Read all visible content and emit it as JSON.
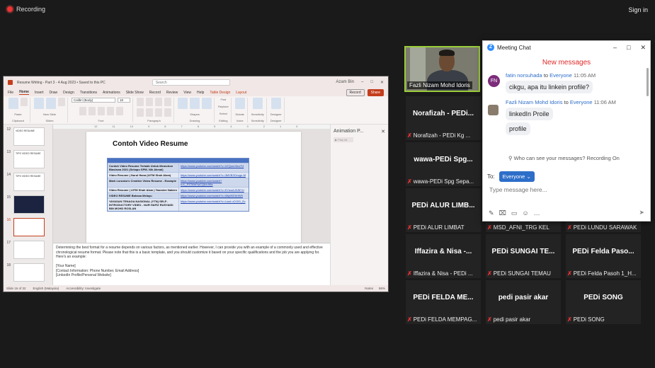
{
  "topbar": {
    "recording": "Recording",
    "signin": "Sign in"
  },
  "ppt": {
    "title": "Resume Writing - Part 3 - 4 Aug 2023 • Saved to this PC",
    "search": "Search",
    "user": "Azam Bin",
    "menu": [
      "File",
      "Home",
      "Insert",
      "Draw",
      "Design",
      "Transitions",
      "Animations",
      "Slide Show",
      "Record",
      "Review",
      "View",
      "Help",
      "Table Design",
      "Layout"
    ],
    "record_btn": "Record",
    "share_btn": "Share",
    "ribbon": {
      "clipboard": "Clipboard",
      "slides": "Slides",
      "font": "Font",
      "paragraph": "Paragraph",
      "drawing": "Drawing",
      "editing": "Editing",
      "voice": "Voice",
      "sensitivity": "Sensitivity",
      "designer": "Designer",
      "font_name": "Calibri (Body)",
      "font_size": "18",
      "paste": "Paste",
      "new_slide": "New Slide",
      "reuse_slides": "Reuse Slides",
      "shapes": "Shapes",
      "arrange": "Arrange",
      "quick_styles": "Quick Styles",
      "find": "Find",
      "replace": "Replace",
      "select": "Select",
      "dictate": "Dictate",
      "sensitivity_btn": "Sensitivity",
      "designer_btn": "Designer"
    },
    "thumbs": [
      {
        "num": "12",
        "text": "VIDEO RESUME",
        "style": "plain"
      },
      {
        "num": "13",
        "text": "TIPS VIDEO RESUME",
        "style": "plain"
      },
      {
        "num": "14",
        "text": "TIPS VIDEO RESUME",
        "style": "plain"
      },
      {
        "num": "15",
        "text": "",
        "style": "dark"
      },
      {
        "num": "16",
        "text": "",
        "style": "sel"
      },
      {
        "num": "17",
        "text": "",
        "style": "plain"
      },
      {
        "num": "18",
        "text": "",
        "style": "plain"
      }
    ],
    "ruler": [
      "12",
      "11",
      "10",
      "9",
      "8",
      "7",
      "6",
      "5",
      "4",
      "3",
      "2",
      "1",
      "0"
    ],
    "slide": {
      "title": "Contoh Video Resume",
      "rows": [
        {
          "a": "Contoh Video Resume Terbaik Untuk Memohon Biasiswa 2021 (Sekapu SPM- Nik Akmal)",
          "b": "https://www.youtube.com/watch?v=XZQumXbvrF4"
        },
        {
          "a": "Video Resume | Nurul Hana (UiTM Shah Alam)",
          "b": "https://www.youtube.com/watch?v=3MVB3Ovxgo-M"
        },
        {
          "a": "Mark Lorusko's Creative Video Resume - Example",
          "b": "https://www.youtube.com/watch?v=L_PZTAWYpCQ&t=96s"
        },
        {
          "a": "Video Resume | UiTM Shah Alam | Yasmien Naleen",
          "b": "https://www.youtube.com/watch?v=KYwuAJ0J6YU"
        },
        {
          "a": "VIDEO RESUME Bahasa Melayu",
          "b": "https://www.youtube.com/watch?v=t0fq9KEbHW0"
        },
        {
          "a": "YAYASAN TENAGA NASIONAL (YTN) SELF-INTRODUCTORY VIDEO - NUR HAFIZ RUSYAIDI BIN MOHD ROSLAN",
          "b": "https://www.youtube.com/watch?v=Lusd uOJX9_Zo"
        }
      ]
    },
    "notes": "Determining the best format for a resume depends on various factors, as mentioned earlier. However, I can provide you with an example of a commonly used and effective chronological resume format. Please note that this is a basic template, and you should customize it based on your specific qualifications and the job you are applying for. Here's an example:\n\n[Your Name]\n[Contact Information: Phone Number, Email Address]\n[LinkedIn Profile/Personal Website]",
    "anim_pane": {
      "title": "Animation P...",
      "play": "▶ Play All"
    },
    "status": {
      "slide": "Slide 16 of 32",
      "lang": "English (Malaysia)",
      "access": "Accessibility: Investigate",
      "notes": "Notes",
      "zoom": "86%"
    }
  },
  "selfcam": {
    "name": "Fazli Nizam Mohd Idoris"
  },
  "tiles": [
    {
      "big": "Norafizah - PEDi...",
      "small": "Norafizah - PEDi Kg ..."
    },
    {
      "big": "wawa-PEDi Spg...",
      "small": "wawa-PEDi Spg Sepa..."
    },
    {
      "big": "PEDi ALUR LIMB...",
      "small": "PEDi ALUR LIMBAT"
    },
    {
      "big": "",
      "small": "MSD_AFNI_TRG KEL"
    },
    {
      "big": "",
      "small": "PEDi LUNDU SARAWAK"
    },
    {
      "big": "Iffazira & Nisa -...",
      "small": "Iffazira & Nisa - PEDi ..."
    },
    {
      "big": "PEDi SUNGAI TE...",
      "small": "PEDi SUNGAI TEMAU"
    },
    {
      "big": "PEDi Felda Paso...",
      "small": "PEDi Felda Pasoh 1_H..."
    },
    {
      "big": "PEDi FELDA ME...",
      "small": "PEDi FELDA MEMPAG..."
    },
    {
      "big": "pedi pasir akar",
      "small": "pedi pasir akar"
    },
    {
      "big": "PEDi SONG",
      "small": "PEDi SONG"
    }
  ],
  "chat": {
    "title": "Meeting Chat",
    "new_messages": "New messages",
    "messages": [
      {
        "sender": "fatin norsuhada",
        "to_word": "to",
        "to": "Everyone",
        "time": "11:05 AM",
        "avatar": "FN",
        "texts": [
          "cikgu, apa itu linkein profile?"
        ]
      },
      {
        "sender": "Fazli Nizam Mohd Idoris",
        "to_word": "to",
        "to": "Everyone",
        "time": "11:06 AM",
        "avatar": "",
        "texts": [
          "linkedIn Proile",
          "profile"
        ]
      }
    ],
    "who_sees": "Who can see your messages? Recording On",
    "to_label": "To:",
    "recipient": "Everyone",
    "placeholder": "Type message here..."
  },
  "colors": {
    "accent": "#2d8cff",
    "new_messages": "#e02828",
    "ppt_brand": "#c43e1c",
    "active_speaker": "#9ccc3a"
  }
}
